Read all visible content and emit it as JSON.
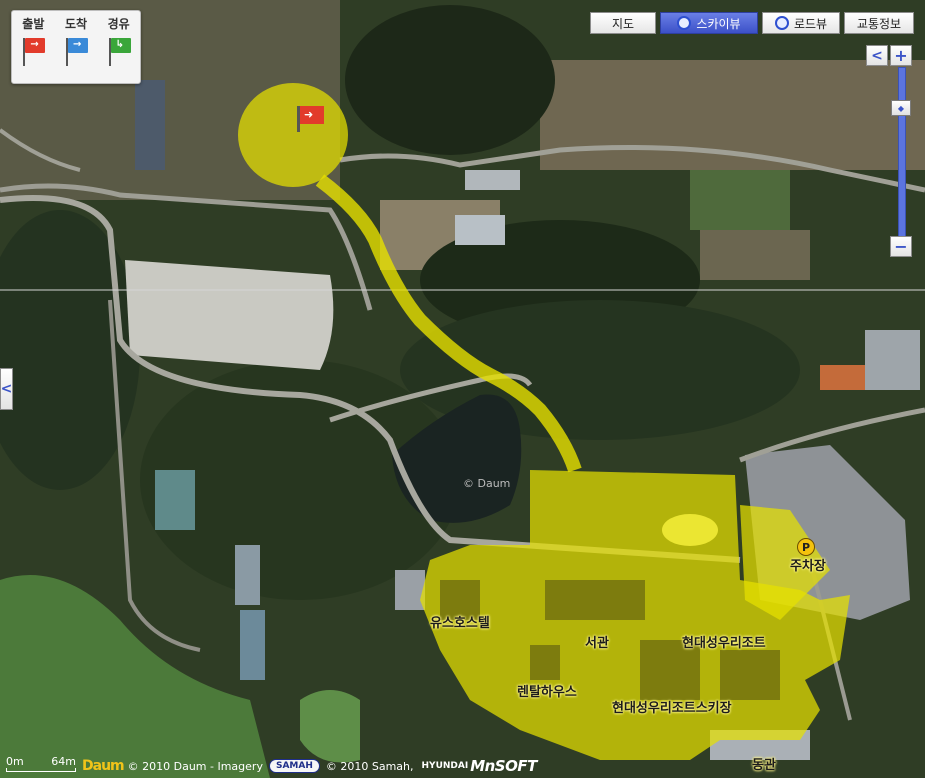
{
  "route_panel": {
    "start_label": "출발",
    "arrive_label": "도착",
    "via_label": "경유",
    "start_color": "#e23b2b",
    "arrive_color": "#3a8ad8",
    "via_color": "#3aa63a"
  },
  "map_types": [
    {
      "label": "지도",
      "active": false
    },
    {
      "label": "스카이뷰",
      "active": true
    },
    {
      "label": "로드뷰",
      "active": false
    },
    {
      "label": "교통정보",
      "active": false
    }
  ],
  "zoom": {
    "plus_label": "+",
    "minus_label": "−",
    "left_arrow": "<"
  },
  "places": {
    "parking": "주차장",
    "parking_icon": "P",
    "youth_hostel": "유스호스텔",
    "west_building": "서관",
    "resort": "현대성우리조트",
    "rental_shop": "렌탈하우스",
    "ski_resort": "현대성우리조트스키장",
    "east_building": "동관",
    "watermark": "© Daum"
  },
  "footer": {
    "scale_start": "0m",
    "scale_end": "64m",
    "daum_logo": "Daum",
    "copyright_daum": "© 2010 Daum - Imagery",
    "samah_logo": "SAMAH",
    "copyright_samah": "© 2010 Samah,",
    "hyundai": "HYUNDAI",
    "mnsoft": "MnSOFT"
  },
  "colors": {
    "highlight": "#e6e000",
    "vegetation_dark": "#2b3b22",
    "field": "#8a7f5e"
  }
}
